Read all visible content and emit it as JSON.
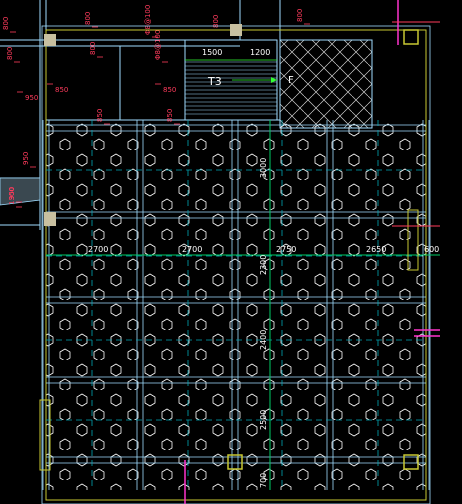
{
  "colors": {
    "background": "#000000",
    "wall": "#9fdcff",
    "grid_green": "#00cc66",
    "dim_green": "#33ff33",
    "text": "#ffffff",
    "pink_red": "#ff3b5c",
    "column_fill": "#c8c0a0",
    "dashed_cyan": "#00a7b5",
    "magenta": "#ff33cc",
    "yellow": "#c8c832"
  },
  "top_red_labels": [
    "800",
    "800",
    "Φ8@100",
    "800",
    "Φ8@100",
    "800",
    "800",
    "800",
    "850",
    "950",
    "850",
    "850",
    "850",
    "950",
    "950",
    "1300"
  ],
  "stair": {
    "label": "T3",
    "dims": [
      "1500",
      "1200"
    ],
    "up_marker": "F"
  },
  "horizontal_dims": [
    "2700",
    "2700",
    "2750",
    "2650",
    "600"
  ],
  "vertical_dims": [
    "3000",
    "2300",
    "2400",
    "2500",
    "700"
  ],
  "icons": [
    "hexagon-waffle-pattern",
    "herringbone-hatch",
    "column-marker"
  ]
}
